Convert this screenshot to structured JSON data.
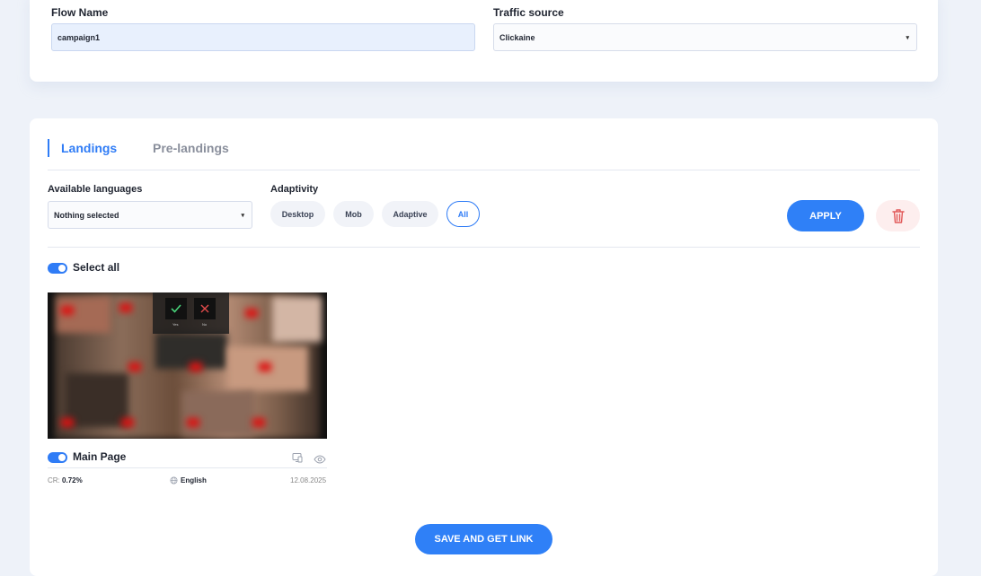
{
  "flow": {
    "name_label": "Flow Name",
    "name_value": "campaign1",
    "source_label": "Traffic source",
    "source_value": "Clickaine"
  },
  "tabs": [
    {
      "label": "Landings",
      "active": true
    },
    {
      "label": "Pre-landings",
      "active": false
    }
  ],
  "filters": {
    "languages_label": "Available languages",
    "languages_value": "Nothing selected",
    "adaptivity_label": "Adaptivity",
    "adaptivity_options": [
      "Desktop",
      "Mob",
      "Adaptive",
      "All"
    ],
    "adaptivity_selected": "All",
    "apply_label": "APPLY"
  },
  "select_all_label": "Select all",
  "landing": {
    "title": "Main Page",
    "cr_label": "CR:",
    "cr_value": "0.72%",
    "language": "English",
    "date": "12.08.2025",
    "overlay_yes": "Yes",
    "overlay_no": "No"
  },
  "save_label": "SAVE AND GET LINK",
  "colors": {
    "accent": "#2f80f7",
    "delete_bg": "#fdeeee",
    "delete_icon": "#e25a5a"
  }
}
